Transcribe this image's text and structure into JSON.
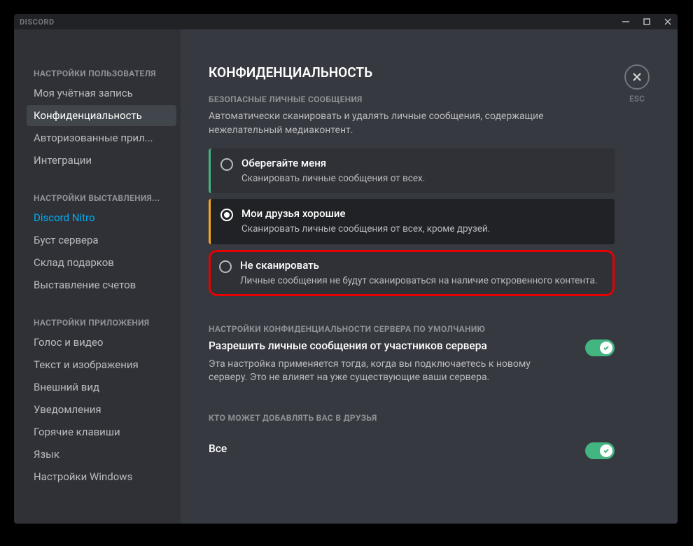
{
  "titlebar": {
    "app_name": "DISCORD"
  },
  "close_button": {
    "label": "ESC"
  },
  "sidebar": {
    "sections": [
      {
        "header": "НАСТРОЙКИ ПОЛЬЗОВАТЕЛЯ",
        "items": [
          {
            "label": "Моя учётная запись"
          },
          {
            "label": "Конфиденциальность",
            "active": true
          },
          {
            "label": "Авторизованные прил..."
          },
          {
            "label": "Интеграции"
          }
        ]
      },
      {
        "header": "НАСТРОЙКИ ВЫСТАВЛЕНИЯ...",
        "items": [
          {
            "label": "Discord Nitro",
            "link": true
          },
          {
            "label": "Буст сервера"
          },
          {
            "label": "Склад подарков"
          },
          {
            "label": "Выставление счетов"
          }
        ]
      },
      {
        "header": "НАСТРОЙКИ ПРИЛОЖЕНИЯ",
        "items": [
          {
            "label": "Голос и видео"
          },
          {
            "label": "Текст и изображения"
          },
          {
            "label": "Внешний вид"
          },
          {
            "label": "Уведомления"
          },
          {
            "label": "Горячие клавиши"
          },
          {
            "label": "Язык"
          },
          {
            "label": "Настройки Windows"
          }
        ]
      }
    ]
  },
  "page": {
    "title": "КОНФИДЕНЦИАЛЬНОСТЬ",
    "safe_dm": {
      "header": "БЕЗОПАСНЫЕ ЛИЧНЫЕ СООБЩЕНИЯ",
      "description": "Автоматически сканировать и удалять личные сообщения, содержащие нежелательный медиаконтент.",
      "options": [
        {
          "title": "Оберегайте меня",
          "desc": "Сканировать личные сообщения от всех."
        },
        {
          "title": "Мои друзья хорошие",
          "desc": "Сканировать личные сообщения от всех, кроме друзей.",
          "selected": true
        },
        {
          "title": "Не сканировать",
          "desc": "Личные сообщения не будут сканироваться на наличие откровенного контента."
        }
      ]
    },
    "server_defaults": {
      "header": "НАСТРОЙКИ КОНФИДЕНЦИАЛЬНОСТИ СЕРВЕРА ПО УМОЛЧАНИЮ",
      "toggle_label": "Разрешить личные сообщения от участников сервера",
      "toggle_desc": "Эта настройка применяется тогда, когда вы подключаетесь к новому серверу. Это не влияет на уже существующие ваши сервера.",
      "toggle_on": true
    },
    "friends": {
      "header": "КТО МОЖЕТ ДОБАВЛЯТЬ ВАС В ДРУЗЬЯ",
      "row1_label": "Все",
      "row1_on": true
    }
  }
}
